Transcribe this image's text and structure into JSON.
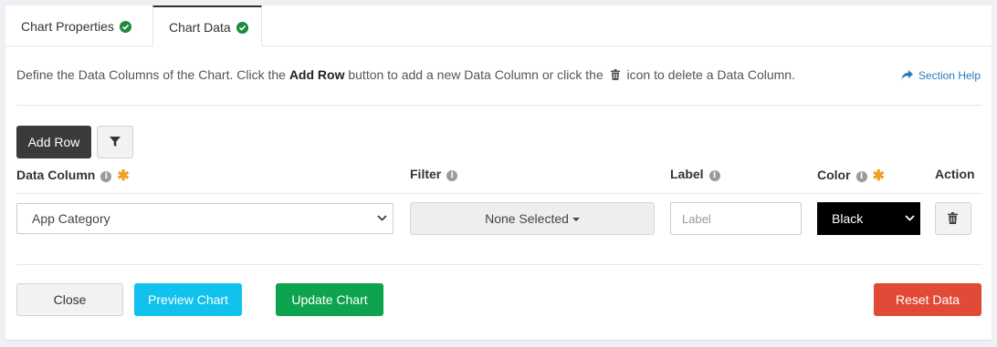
{
  "tabs": [
    {
      "label": "Chart Properties"
    },
    {
      "label": "Chart Data"
    }
  ],
  "intro": {
    "part1": "Define the Data Columns of the Chart. Click the ",
    "bold": "Add Row",
    "part2": " button to add a new Data Column or click the ",
    "part3": " icon to delete a Data Column."
  },
  "section_help": "Section Help",
  "toolbar": {
    "add_row": "Add Row"
  },
  "columns": {
    "data_column": "Data Column",
    "filter": "Filter",
    "label": "Label",
    "color": "Color",
    "action": "Action"
  },
  "row": {
    "data_column_value": "App Category",
    "filter_value": "None Selected",
    "label_placeholder": "Label",
    "label_value": "",
    "color_value": "Black"
  },
  "footer": {
    "close": "Close",
    "preview": "Preview Chart",
    "update": "Update Chart",
    "reset": "Reset Data"
  },
  "colors": {
    "success": "#1e8a3c",
    "dark": "#3a3a3a",
    "preview": "#11c1ee",
    "update": "#0ea34f",
    "reset": "#e04a36",
    "required": "#f0a020",
    "link": "#2a7ab8"
  },
  "icons": [
    "check-circle-icon",
    "trash-icon",
    "share-icon",
    "filter-icon",
    "info-icon",
    "asterisk-icon",
    "chevron-down-icon",
    "caret-down-icon"
  ]
}
